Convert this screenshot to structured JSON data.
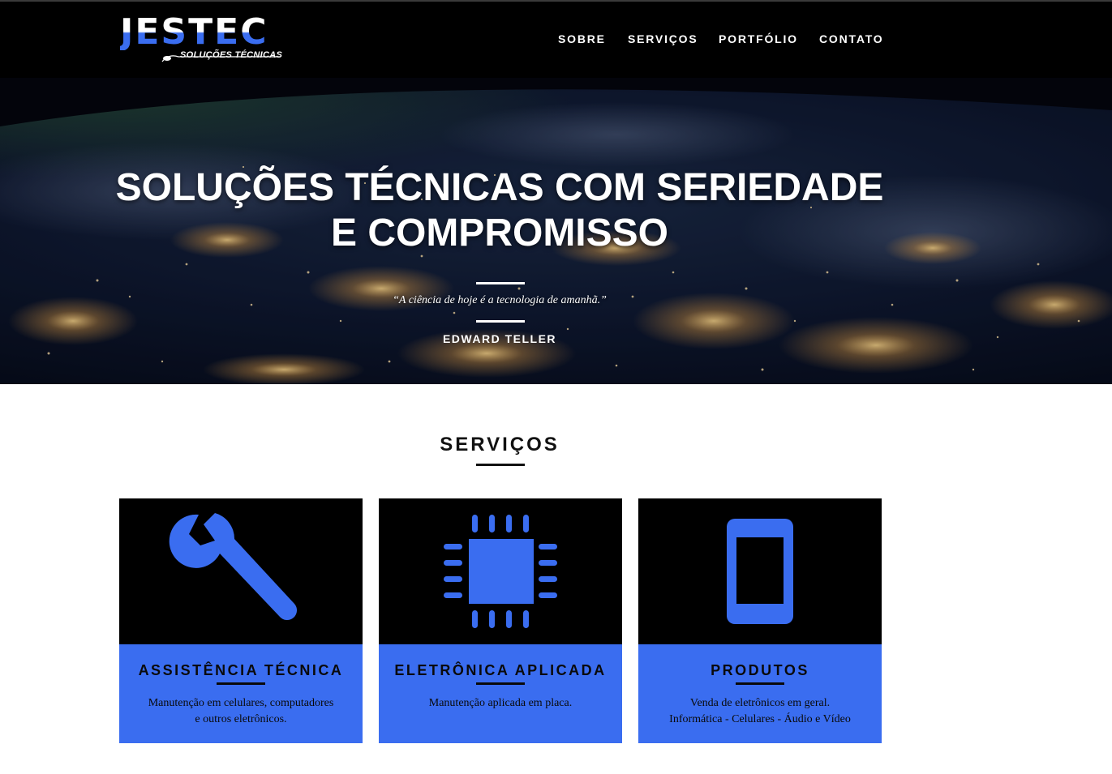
{
  "colors": {
    "accent": "#3a6df0",
    "navbar": "#000000",
    "text_dark": "#0a0a0a"
  },
  "logo": {
    "main": "JESTEC",
    "sub": "SOLUÇÕES TÉCNICAS"
  },
  "nav": {
    "items": [
      {
        "label": "SOBRE"
      },
      {
        "label": "SERVIÇOS"
      },
      {
        "label": "PORTFÓLIO"
      },
      {
        "label": "CONTATO"
      }
    ]
  },
  "hero": {
    "title_line1": "SOLUÇÕES TÉCNICAS COM SERIEDADE",
    "title_line2": "E COMPROMISSO",
    "quote": "“A ciência de hoje é a tecnologia de amanhã.”",
    "author": "EDWARD TELLER"
  },
  "services": {
    "title": "SERVIÇOS",
    "cards": [
      {
        "icon": "wrench-icon",
        "title": "ASSISTÊNCIA TÉCNICA",
        "text_line1": "Manutenção em celulares, computadores",
        "text_line2": "e outros eletrônicos."
      },
      {
        "icon": "chip-icon",
        "title": "ELETRÔNICA APLICADA",
        "text_line1": "Manutenção aplicada em placa.",
        "text_line2": ""
      },
      {
        "icon": "smartphone-icon",
        "title": "PRODUTOS",
        "text_line1": "Venda de eletrônicos em geral.",
        "text_line2": "Informática - Celulares - Áudio e Vídeo"
      }
    ]
  }
}
